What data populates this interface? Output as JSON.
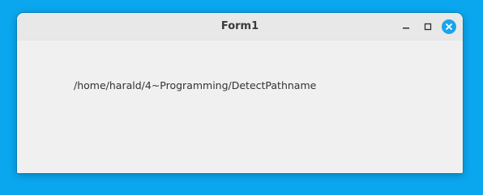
{
  "window": {
    "title": "Form1",
    "controls": {
      "minimize_icon": "minimize-icon",
      "maximize_icon": "maximize-icon",
      "close_icon": "close-icon"
    }
  },
  "content": {
    "path_label": "/home/harald/4~Programming/DetectPathname"
  },
  "colors": {
    "desktop": "#0aa7ef",
    "window_bg": "#f0f0f0",
    "titlebar_bg": "#e8e8e8",
    "close_button": "#1aa4ec",
    "text": "#333333"
  }
}
